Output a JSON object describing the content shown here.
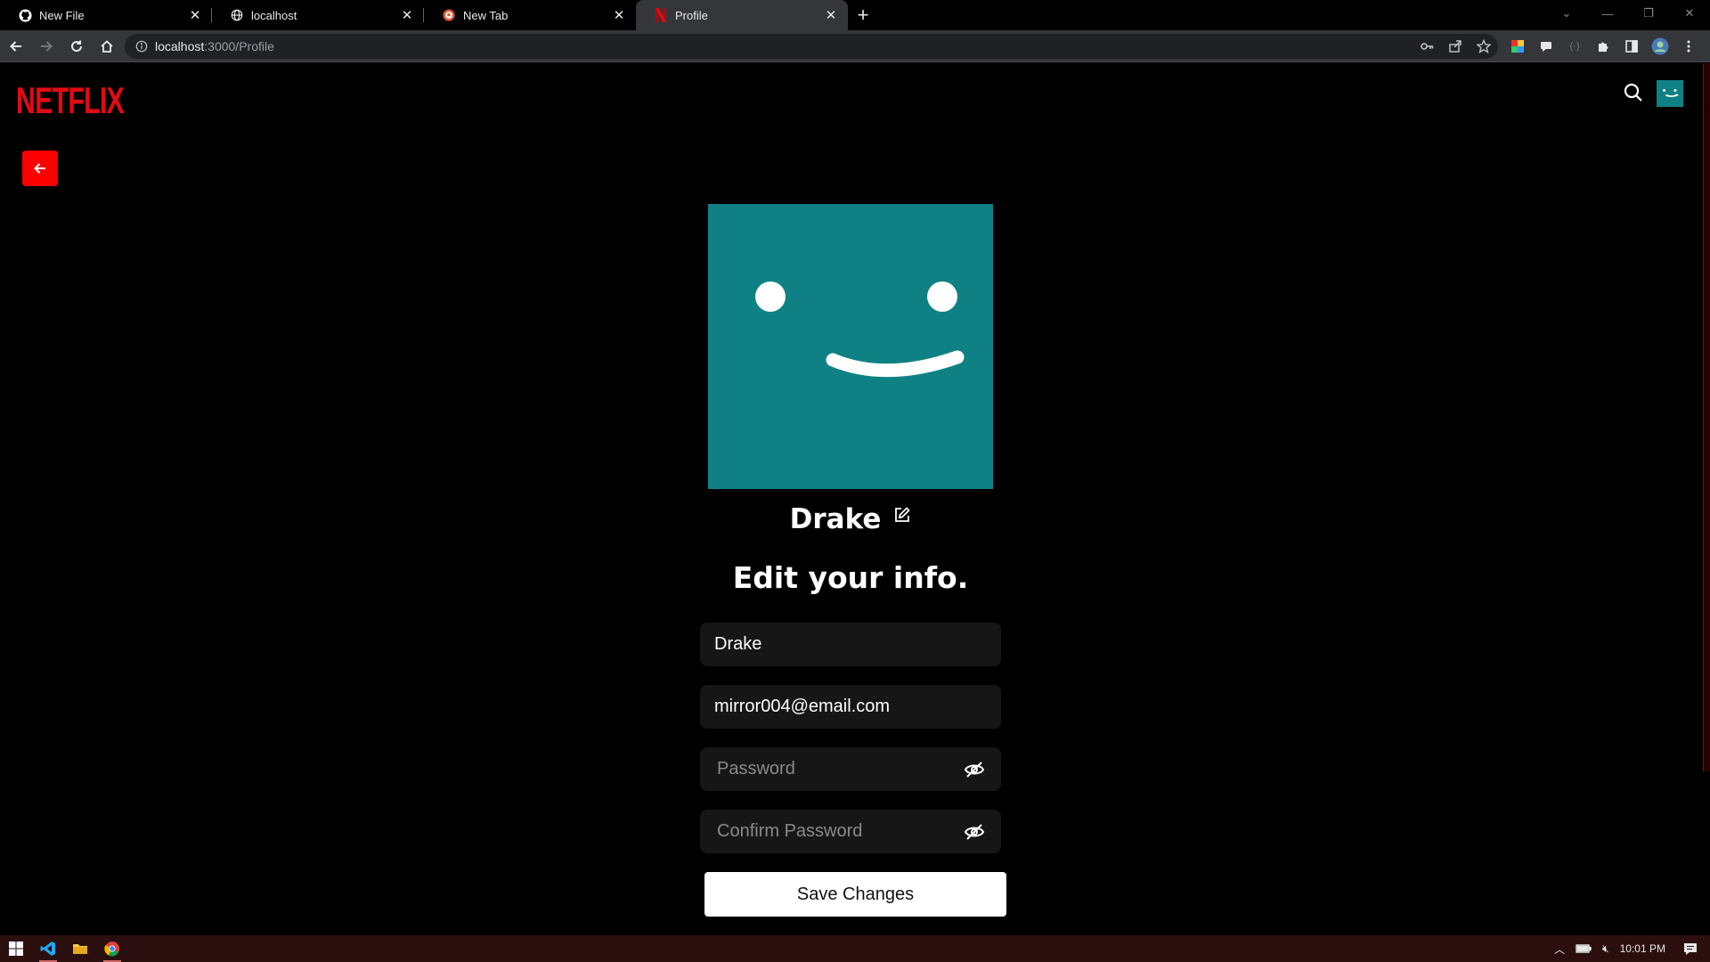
{
  "browser": {
    "tabs": [
      {
        "title": "New File",
        "icon": "github-icon"
      },
      {
        "title": "localhost",
        "icon": "globe-icon"
      },
      {
        "title": "New Tab",
        "icon": "duckduckgo-icon"
      },
      {
        "title": "Profile",
        "icon": "netflix-icon"
      }
    ],
    "active_tab": 3,
    "url_host": "localhost",
    "url_path": ":3000/Profile"
  },
  "page": {
    "logo": "NETFLIX",
    "profile_name": "Drake",
    "heading": "Edit your info.",
    "form": {
      "name_value": "Drake",
      "email_value": "mirror004@email.com",
      "password_placeholder": "Password",
      "confirm_placeholder": "Confirm Password",
      "save_label": "Save Changes"
    },
    "colors": {
      "brand": "#e50914",
      "avatar": "#0f8184",
      "back_button": "#ff0000"
    }
  },
  "taskbar": {
    "clock": "10:01 PM"
  }
}
